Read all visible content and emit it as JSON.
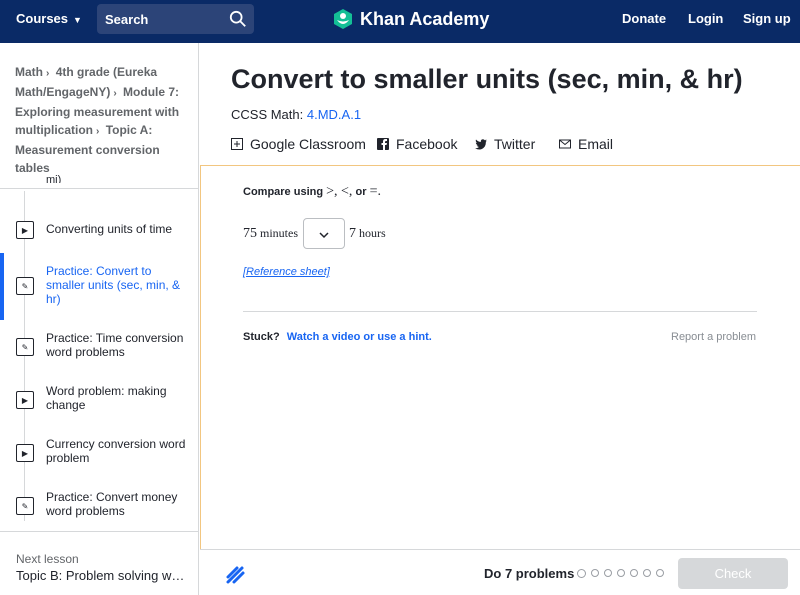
{
  "nav": {
    "courses": "Courses",
    "search_placeholder": "Search",
    "brand": "Khan Academy",
    "donate": "Donate",
    "login": "Login",
    "signup": "Sign up"
  },
  "breadcrumb": [
    "Math",
    "4th grade (Eureka Math/EngageNY)",
    "Module 7: Exploring measurement with multiplication",
    "Topic A: Measurement conversion tables"
  ],
  "sidebar": {
    "cut_text": "mi)",
    "items": [
      {
        "label": "Converting units of time",
        "kind": "video"
      },
      {
        "label": "Practice: Convert to smaller units (sec, min, & hr)",
        "kind": "exercise"
      },
      {
        "label": "Practice: Time conversion word problems",
        "kind": "exercise"
      },
      {
        "label": "Word problem: making change",
        "kind": "video"
      },
      {
        "label": "Currency conversion word problem",
        "kind": "video"
      },
      {
        "label": "Practice: Convert money word problems",
        "kind": "exercise"
      }
    ],
    "next_caption": "Next lesson",
    "next_title": "Topic B: Problem solving with the addition of measures"
  },
  "page": {
    "title": "Convert to smaller units (sec, min, & hr)",
    "ccss_label": "CCSS Math:",
    "ccss_code": "4.MD.A.1"
  },
  "share": {
    "google": "Google Classroom",
    "facebook": "Facebook",
    "twitter": "Twitter",
    "email": "Email"
  },
  "exercise": {
    "prompt_prefix": "Compare using",
    "prompt_symbols": ">, <,",
    "prompt_or": "or",
    "prompt_eq": "=.",
    "left_value": "75",
    "left_unit": "minutes",
    "right_value": "7",
    "right_unit": "hours",
    "reference": "[Reference sheet]",
    "stuck": "Stuck?",
    "hint_link": "Watch a video or use a hint.",
    "report": "Report a problem"
  },
  "footer": {
    "do_problems": "Do 7 problems",
    "problem_count": 7,
    "check": "Check"
  },
  "colors": {
    "nav_bg": "#0a2a66",
    "accent": "#1865f2",
    "panel_border": "#f2c680",
    "check_disabled": "#d6d8da"
  }
}
